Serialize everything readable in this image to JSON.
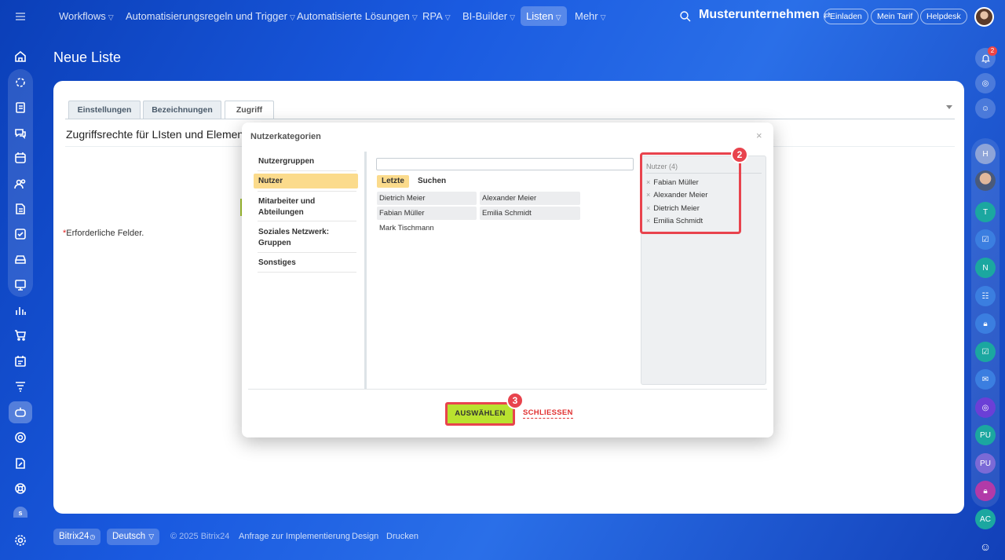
{
  "topnav": {
    "menu_icon": "hamburger-icon",
    "items": [
      {
        "label": "Workflows",
        "dropdown": true
      },
      {
        "label": "Automatisierungsregeln und Trigger",
        "dropdown": true
      },
      {
        "label": "Automatisierte Lösungen",
        "dropdown": true
      },
      {
        "label": "RPA",
        "dropdown": true
      },
      {
        "label": "BI-Builder",
        "dropdown": true
      },
      {
        "label": "Listen",
        "dropdown": true,
        "active": true
      },
      {
        "label": "Mehr",
        "dropdown": true
      }
    ],
    "company": "Musterunternehmen",
    "invite": "Einladen",
    "tariff": "Mein Tarif",
    "helpdesk": "Helpdesk"
  },
  "page": {
    "title": "Neue Liste"
  },
  "tabs": [
    "Einstellungen",
    "Bezeichnungen",
    "Zugriff"
  ],
  "section_title": "Zugriffsrechte für LIsten und Elemen",
  "required_note": "Erforderliche Felder.",
  "required_star": "*",
  "dialog": {
    "title": "Nutzerkategorien",
    "close_glyph": "×",
    "categories": [
      "Nutzergruppen",
      "Nutzer",
      "Mitarbeiter und Abteilungen",
      "Soziales Netzwerk: Gruppen",
      "Sonstiges"
    ],
    "selected_category": "Nutzer",
    "subtabs": [
      "Letzte",
      "Suchen"
    ],
    "search_value": "",
    "users": [
      "Dietrich Meier",
      "Alexander Meier",
      "Fabian Müller",
      "Emilia Schmidt",
      "Mark Tischmann"
    ],
    "selected_header": "Nutzer (4)",
    "selected_users": [
      "Fabian Müller",
      "Alexander Meier",
      "Dietrich Meier",
      "Emilia Schmidt"
    ],
    "remove_glyph": "×",
    "select_button": "AUSWÄHLEN",
    "close_button": "SCHLIESSEN"
  },
  "annotations": {
    "badge_2": "2",
    "badge_3": "3",
    "highlight_color": "#e8434d"
  },
  "right_bar": {
    "notification_count": "2",
    "initials": [
      "H",
      "T",
      "N",
      "PU",
      "PU",
      "AC"
    ]
  },
  "footer": {
    "brand": "Bitrix24",
    "language": "Deutsch",
    "copyright": "© 2025 Bitrix24",
    "links": [
      "Anfrage zur Implementierung",
      "Design",
      "Drucken"
    ]
  },
  "colors": {
    "accent_green": "#b9e22f",
    "selected_yellow": "#fbdb8c",
    "brand_blue": "#1a5ae0"
  }
}
